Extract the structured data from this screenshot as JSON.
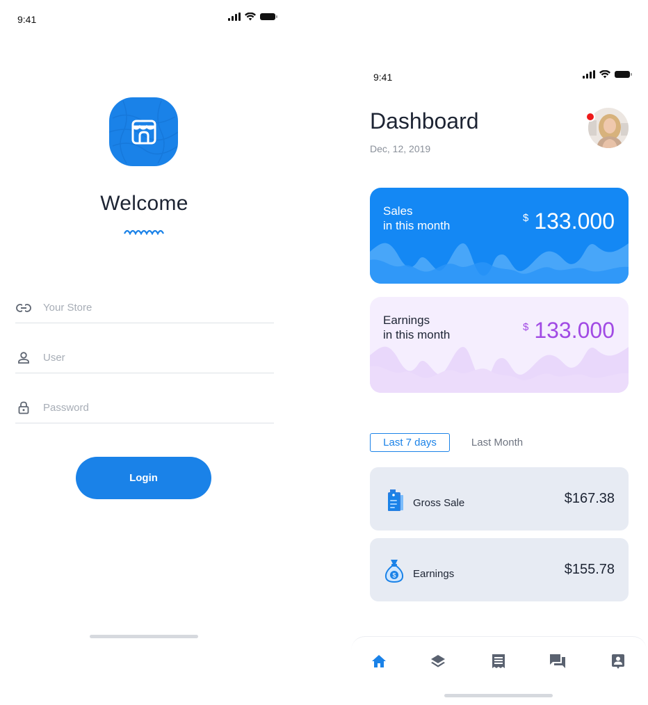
{
  "login": {
    "status_time": "9:41",
    "logo_icon": "storefront-icon",
    "welcome_text": "Welcome",
    "fields": {
      "store": {
        "placeholder": "Your Store",
        "icon": "link-icon",
        "value": ""
      },
      "user": {
        "placeholder": "User",
        "icon": "user-icon",
        "value": ""
      },
      "password": {
        "placeholder": "Password",
        "icon": "lock-icon",
        "value": ""
      }
    },
    "login_label": "Login"
  },
  "dashboard": {
    "status_time": "9:41",
    "title": "Dashboard",
    "date": "Dec, 12, 2019",
    "sales_card": {
      "label_line1": "Sales",
      "label_line2": "in this month",
      "currency": "$",
      "value": "133.000"
    },
    "earnings_card": {
      "label_line1": "Earnings",
      "label_line2": "in this month",
      "currency": "$",
      "value": "133.000"
    },
    "tabs": {
      "active": "Last 7 days",
      "inactive": "Last Month"
    },
    "stats": [
      {
        "label": "Gross Sale",
        "value": "$167.38",
        "icon": "price-tag-icon"
      },
      {
        "label": "Earnings",
        "value": "$155.78",
        "icon": "money-bag-icon"
      }
    ],
    "tabbar": [
      "home-icon",
      "layers-icon",
      "receipt-icon",
      "chat-icon",
      "contact-icon"
    ]
  },
  "colors": {
    "primary": "#1a82e8",
    "sales_card": "#1488f4",
    "earnings_card": "#f5eefe",
    "earnings_value": "#a14ae4",
    "stat_card": "#e7ebf3",
    "notification_dot": "#ee1a1a"
  }
}
